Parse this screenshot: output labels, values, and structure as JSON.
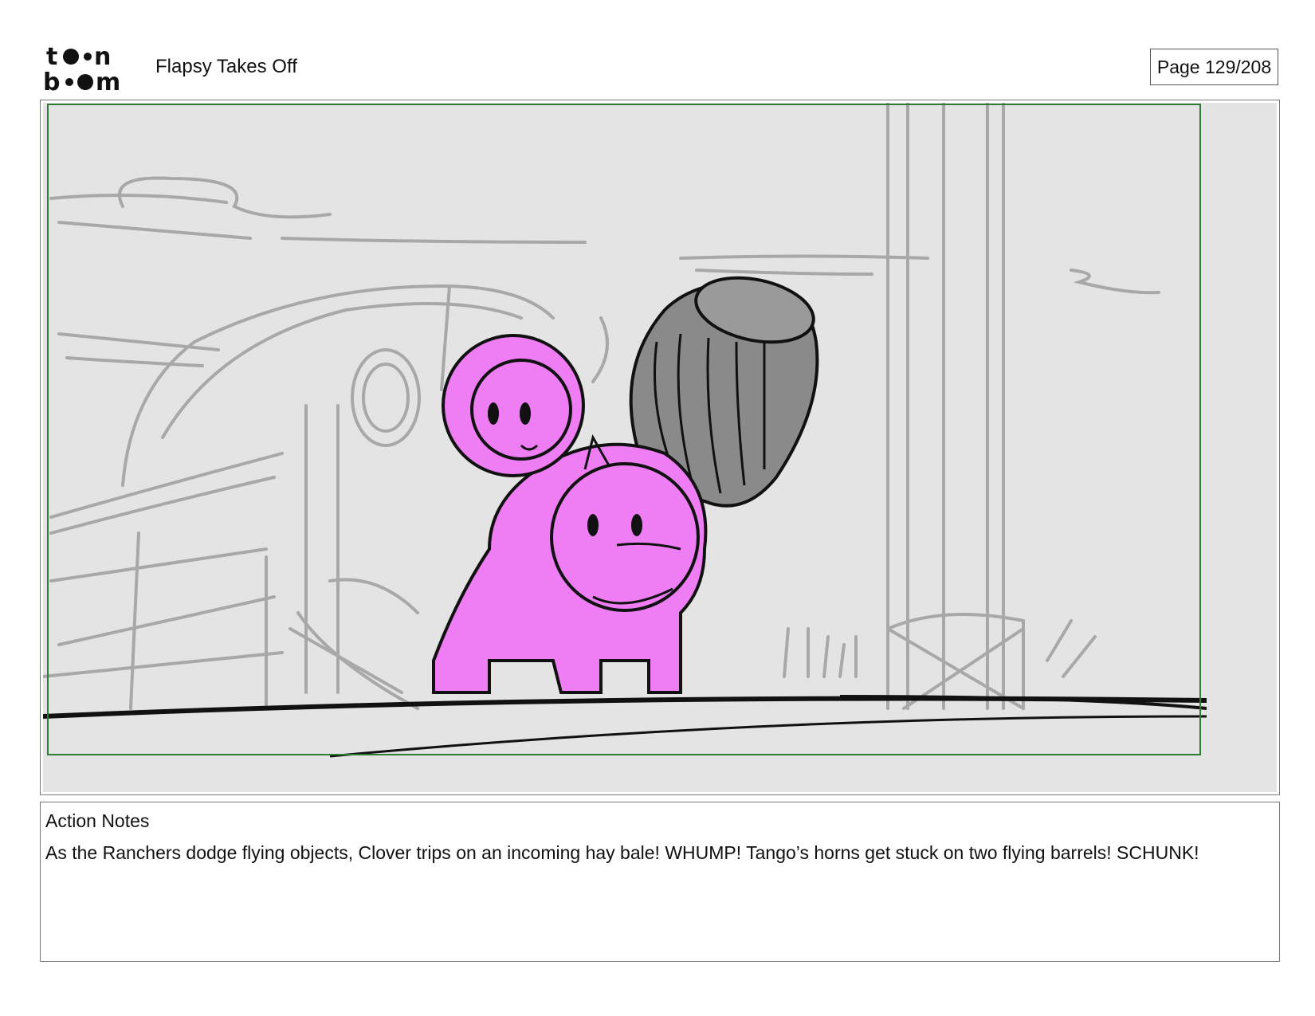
{
  "header": {
    "logo_text_top": "toon",
    "logo_text_bottom": "boom",
    "project_title": "Flapsy Takes Off",
    "page_label": "Page 129/208"
  },
  "panel": {
    "description_free": true,
    "colors": {
      "background": "#e4e4e4",
      "sketch_gray": "#a8a8a8",
      "character_fill": "#ef7ef5",
      "barrel_fill": "#8a8a8a",
      "safe_frame": "#2e7d32",
      "ink": "#111111"
    }
  },
  "notes": {
    "label": "Action Notes",
    "text": "As the Ranchers dodge flying objects, Clover trips on an incoming hay bale! WHUMP! Tango’s horns get stuck on two flying barrels! SCHUNK!"
  }
}
